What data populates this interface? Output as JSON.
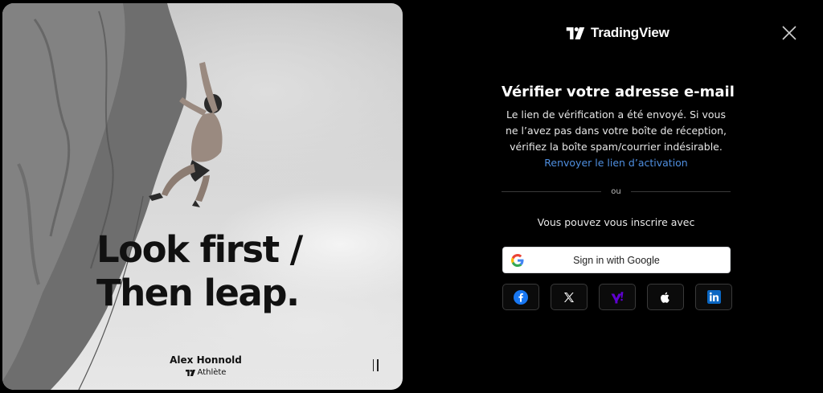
{
  "promo": {
    "headline_line1": "Look first /",
    "headline_line2": "Then leap.",
    "athlete_name": "Alex Honnold",
    "athlete_role": "Athlète"
  },
  "header": {
    "brand": "TradingView"
  },
  "verify": {
    "title": "Vérifier votre adresse e-mail",
    "description": "Le lien de vérification a été envoyé. Si vous ne l’avez pas dans votre boîte de réception, vérifiez la boîte spam/courrier indésirable.",
    "resend_link": "Renvoyer le lien d’activation",
    "or": "ou",
    "signup_text": "Vous pouvez vous inscrire avec"
  },
  "google": {
    "label": "Sign in with Google"
  },
  "socials": [
    {
      "icon": "facebook-icon",
      "color": "#1877f2"
    },
    {
      "icon": "x-icon",
      "color": "#ffffff"
    },
    {
      "icon": "yahoo-icon",
      "color": "#6001d2"
    },
    {
      "icon": "apple-icon",
      "color": "#ffffff"
    },
    {
      "icon": "linkedin-icon",
      "color": "#0a66c2"
    }
  ],
  "colors": {
    "background": "#000000",
    "link": "#4f8fe0"
  }
}
